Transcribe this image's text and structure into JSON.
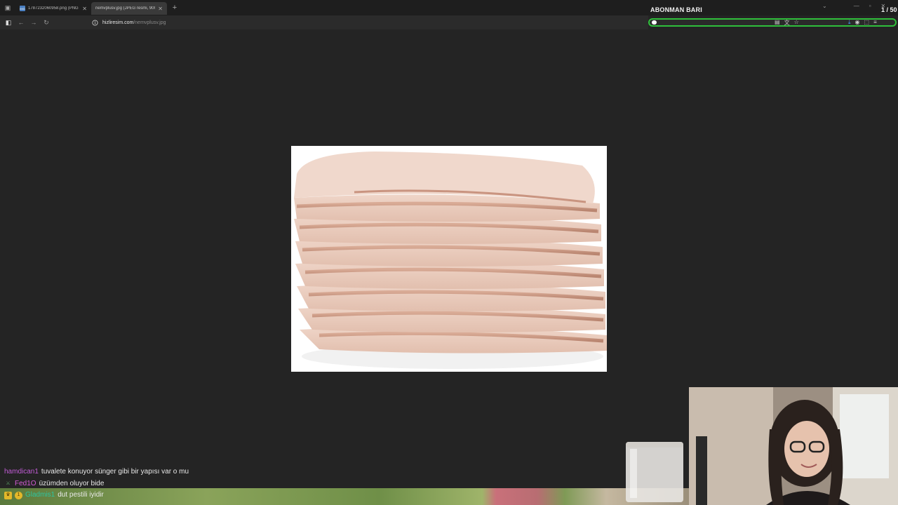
{
  "tabs": [
    {
      "title": "1787232060958.png (PNG resmi, ...",
      "favicon": "IMG",
      "active": false
    },
    {
      "title": "nemvplusv.jpg (JPEG resmi, 900 × 6...",
      "active": true
    }
  ],
  "address": {
    "host": "hizliresim.com",
    "path": "/nemvplusv.jpg"
  },
  "overlay": {
    "title": "ABONMAN BARI",
    "count": "1 / 50",
    "progress": 0.02,
    "accent": "#2fbf3b"
  },
  "chat": [
    {
      "user": "hamdican1",
      "color": "#c15cd6",
      "message": "tuvalete konuyor sünger gibi bir yapısı var o mu",
      "badges": []
    },
    {
      "user": "Fed1O",
      "color": "#d45cd6",
      "message": "üzümden oluyor bide",
      "badges": [
        "sword-icon"
      ]
    },
    {
      "user": "Gladmis1",
      "color": "#2ec4a0",
      "message": "dut pestili iyidir",
      "badges": [
        "crown-icon",
        "coin-icon"
      ]
    }
  ]
}
